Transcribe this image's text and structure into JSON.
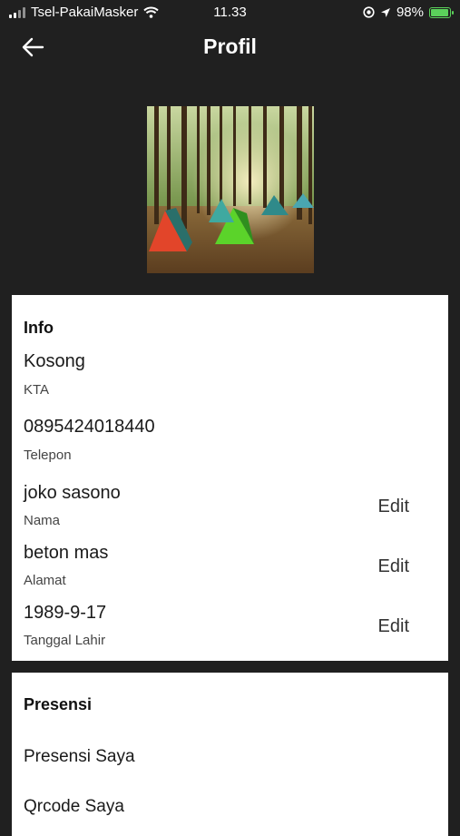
{
  "status_bar": {
    "carrier": "Tsel-PakaiMasker",
    "time": "11.33",
    "battery_text": "98%",
    "battery_level": 0.98,
    "icons": [
      "signal-icon",
      "wifi-icon",
      "location-lock-icon",
      "location-arrow-icon",
      "battery-charging-icon"
    ]
  },
  "header": {
    "title": "Profil",
    "back_icon": "arrow-left-icon"
  },
  "profile_photo": {
    "description_icon": "camping-tents-forest-photo"
  },
  "info": {
    "title": "Info",
    "fields": [
      {
        "value": "Kosong",
        "label": "KTA"
      },
      {
        "value": "0895424018440",
        "label": "Telepon"
      },
      {
        "value": "joko sasono",
        "label": "Nama",
        "edit": "Edit"
      },
      {
        "value": "beton mas",
        "label": "Alamat",
        "edit": "Edit"
      },
      {
        "value": "1989-9-17",
        "label": "Tanggal Lahir",
        "edit": "Edit"
      }
    ]
  },
  "presensi": {
    "title": "Presensi",
    "items": [
      "Presensi Saya",
      "Qrcode Saya"
    ]
  },
  "colors": {
    "background": "#202020",
    "card": "#ffffff",
    "battery": "#5bd15b"
  }
}
